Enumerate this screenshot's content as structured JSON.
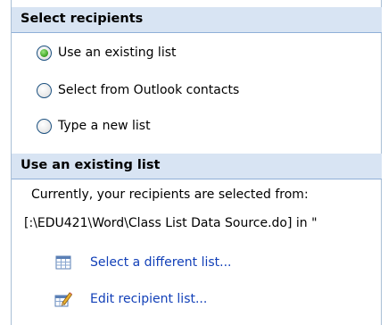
{
  "sections": {
    "select_recipients": {
      "title": "Select recipients",
      "options": [
        {
          "label": "Use an existing list",
          "selected": true
        },
        {
          "label": "Select from Outlook contacts",
          "selected": false
        },
        {
          "label": "Type a new list",
          "selected": false
        }
      ]
    },
    "use_existing": {
      "title": "Use an existing list",
      "info_line1": "Currently, your recipients are selected from:",
      "info_line2": "[:\\EDU421\\Word\\Class List Data Source.do] in \"",
      "links": [
        {
          "label": "Select a different list...",
          "icon": "table-grid-icon"
        },
        {
          "label": "Edit recipient list...",
          "icon": "edit-list-pencil-icon"
        }
      ]
    }
  },
  "colors": {
    "header_bg": "#d8e4f3",
    "link": "#1240b8",
    "radio_selected": "#3aa01f"
  }
}
